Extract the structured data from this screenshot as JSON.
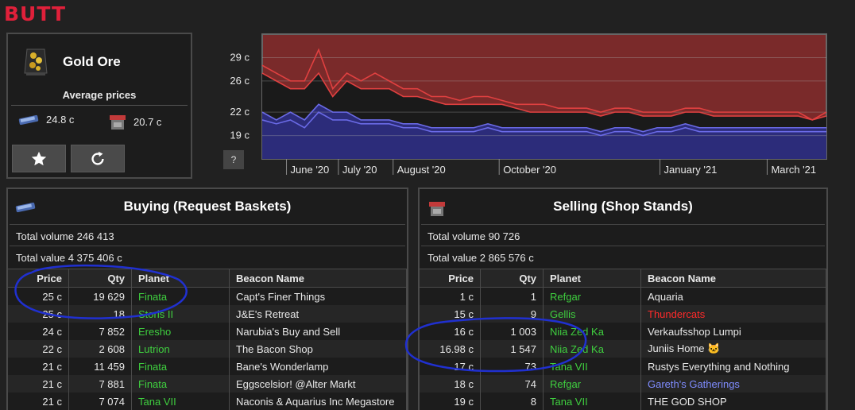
{
  "app": {
    "logo": "BUTT"
  },
  "item": {
    "name": "Gold Ore",
    "avg_title": "Average prices",
    "buy_avg": "24.8 c",
    "sell_avg": "20.7 c",
    "icons": {
      "item": "gold-ore-icon",
      "buy": "request-basket-icon",
      "sell": "shop-stand-icon"
    },
    "buttons": {
      "favorite": "star-icon",
      "refresh": "refresh-icon"
    }
  },
  "chart_help_label": "?",
  "chart_data": {
    "type": "area",
    "x_axis_labels": [
      "June '20",
      "July '20",
      "August '20",
      "October '20",
      "January '21",
      "March '21"
    ],
    "y_tick_labels": [
      "29 c",
      "26 c",
      "22 c",
      "19 c"
    ],
    "ylim": [
      16,
      32
    ],
    "grid": true,
    "x": [
      0,
      1,
      2,
      3,
      4,
      5,
      6,
      7,
      8,
      9,
      10,
      11,
      12,
      13,
      14,
      15,
      16,
      17,
      18,
      19,
      20,
      21,
      22,
      23,
      24,
      25,
      26,
      27,
      28,
      29,
      30,
      31,
      32,
      33,
      34,
      35,
      36,
      37,
      38,
      39,
      40
    ],
    "series": [
      {
        "color": "#e04040",
        "values": [
          28,
          27,
          26,
          26,
          30,
          25,
          27,
          26,
          27,
          26,
          25,
          25,
          24,
          24,
          23.5,
          24,
          24,
          23.5,
          23,
          23,
          23,
          22.5,
          22.5,
          22.5,
          22,
          22.5,
          22.5,
          22,
          22,
          22,
          22.5,
          22.5,
          22,
          22,
          22,
          22,
          22,
          22,
          22,
          21,
          22
        ]
      },
      {
        "color": "#e04040",
        "values": [
          27,
          26,
          25,
          25,
          27,
          24,
          26,
          25,
          25,
          25,
          24,
          24,
          23.5,
          23,
          23,
          23,
          23,
          23,
          22.5,
          22,
          22,
          22,
          22,
          22,
          21.5,
          22,
          22,
          21.5,
          21.5,
          21.5,
          22,
          22,
          21.5,
          21.5,
          21.5,
          21.5,
          21.5,
          21.5,
          21.5,
          21,
          21.5
        ]
      },
      {
        "color": "#6a6ae6",
        "values": [
          22,
          21,
          22,
          21,
          23,
          22,
          22,
          21,
          21,
          21,
          20.5,
          20.5,
          20,
          20,
          20,
          20,
          20.5,
          20,
          20,
          20,
          20,
          20,
          20,
          20,
          19.5,
          20,
          20,
          19.5,
          20,
          20,
          20.5,
          20,
          20,
          20,
          20,
          20,
          20,
          20,
          20,
          20,
          20
        ]
      },
      {
        "color": "#6a6ae6",
        "values": [
          21,
          20.5,
          21,
          20,
          22,
          21,
          21,
          20.5,
          20.5,
          20.5,
          20,
          20,
          19.5,
          19.5,
          19.5,
          19.5,
          20,
          19.5,
          19.5,
          19.5,
          19.5,
          19.5,
          19.5,
          19.5,
          19,
          19.5,
          19.5,
          19,
          19.5,
          19.5,
          20,
          19.5,
          19.5,
          19.5,
          19.5,
          19.5,
          19.5,
          19.5,
          19.5,
          19.5,
          19.5
        ]
      }
    ],
    "upper_band_color": "#7a2a2a",
    "lower_band_color": "#2c2c7a",
    "gap_color": "#1a1a1a"
  },
  "buying": {
    "title": "Buying (Request Baskets)",
    "total_volume": "Total volume 246 413",
    "total_value": "Total value 4 375 406 c",
    "columns": [
      "Price",
      "Qty",
      "Planet",
      "Beacon Name"
    ],
    "rows": [
      {
        "price": "25 c",
        "qty": "19 629",
        "planet": "Finata",
        "planet_color": "green",
        "beacon": "Capt's Finer Things",
        "beacon_color": ""
      },
      {
        "price": "25 c",
        "qty": "18",
        "planet": "Storis II",
        "planet_color": "green",
        "beacon": "J&E's Retreat",
        "beacon_color": ""
      },
      {
        "price": "24 c",
        "qty": "7 852",
        "planet": "Eresho",
        "planet_color": "green",
        "beacon": "Narubia's Buy and Sell",
        "beacon_color": ""
      },
      {
        "price": "22 c",
        "qty": "2 608",
        "planet": "Lutrion",
        "planet_color": "green",
        "beacon": "The Bacon Shop",
        "beacon_color": ""
      },
      {
        "price": "21 c",
        "qty": "11 459",
        "planet": "Finata",
        "planet_color": "green",
        "beacon": "Bane's Wonderlamp",
        "beacon_color": ""
      },
      {
        "price": "21 c",
        "qty": "7 881",
        "planet": "Finata",
        "planet_color": "green",
        "beacon": "Eggscelsior! @Alter Markt",
        "beacon_color": ""
      },
      {
        "price": "21 c",
        "qty": "7 074",
        "planet": "Tana VII",
        "planet_color": "green",
        "beacon": "Naconis & Aquarius Inc Megastore",
        "beacon_color": ""
      }
    ]
  },
  "selling": {
    "title": "Selling (Shop Stands)",
    "total_volume": "Total volume 90 726",
    "total_value": "Total value 2 865 576 c",
    "columns": [
      "Price",
      "Qty",
      "Planet",
      "Beacon Name"
    ],
    "rows": [
      {
        "price": "1 c",
        "qty": "1",
        "planet": "Refgar",
        "planet_color": "green",
        "beacon": "Aquaria",
        "beacon_color": ""
      },
      {
        "price": "15 c",
        "qty": "9",
        "planet": "Gellis",
        "planet_color": "green",
        "beacon": "Thundercats",
        "beacon_color": "red"
      },
      {
        "price": "16 c",
        "qty": "1 003",
        "planet": "Niia Zed Ka",
        "planet_color": "green",
        "beacon": "Verkaufsshop Lumpi",
        "beacon_color": ""
      },
      {
        "price": "16.98 c",
        "qty": "1 547",
        "planet": "Niia Zed Ka",
        "planet_color": "green",
        "beacon": "Juniis Home 🐱",
        "beacon_color": ""
      },
      {
        "price": "17 c",
        "qty": "73",
        "planet": "Tana VII",
        "planet_color": "green",
        "beacon": "Rustys Everything and Nothing",
        "beacon_color": ""
      },
      {
        "price": "18 c",
        "qty": "74",
        "planet": "Refgar",
        "planet_color": "green",
        "beacon": "Gareth's Gatherings",
        "beacon_color": "blue"
      },
      {
        "price": "19 c",
        "qty": "8",
        "planet": "Tana VII",
        "planet_color": "green",
        "beacon": "THE GOD SHOP",
        "beacon_color": ""
      }
    ]
  }
}
